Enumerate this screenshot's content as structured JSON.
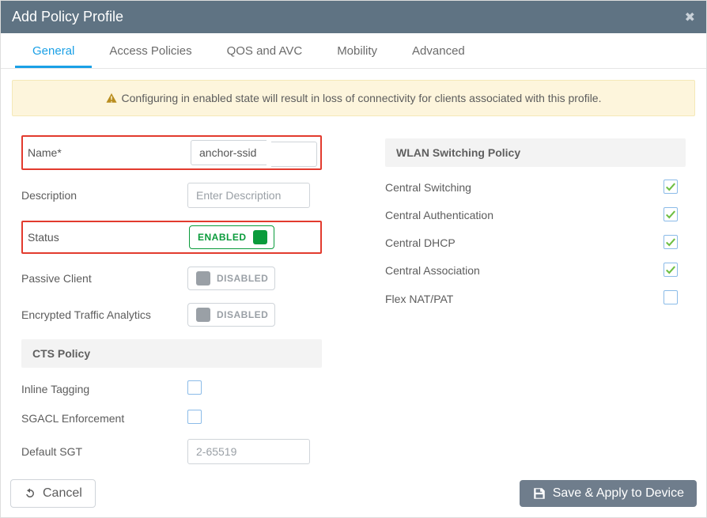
{
  "title": "Add Policy Profile",
  "tabs": [
    "General",
    "Access Policies",
    "QOS and AVC",
    "Mobility",
    "Advanced"
  ],
  "active_tab": 0,
  "alert": "Configuring in enabled state will result in loss of connectivity for clients associated with this profile.",
  "left": {
    "name_label": "Name*",
    "name_value": "anchor-ssid",
    "description_label": "Description",
    "description_placeholder": "Enter Description",
    "status_label": "Status",
    "status_value": "ENABLED",
    "passive_client_label": "Passive Client",
    "passive_client_value": "DISABLED",
    "eta_label": "Encrypted Traffic Analytics",
    "eta_value": "DISABLED",
    "cts_header": "CTS Policy",
    "inline_tagging_label": "Inline Tagging",
    "inline_tagging_checked": false,
    "sgacl_label": "SGACL Enforcement",
    "sgacl_checked": false,
    "default_sgt_label": "Default SGT",
    "default_sgt_placeholder": "2-65519"
  },
  "right": {
    "wlan_header": "WLAN Switching Policy",
    "items": [
      {
        "label": "Central Switching",
        "checked": true
      },
      {
        "label": "Central Authentication",
        "checked": true
      },
      {
        "label": "Central DHCP",
        "checked": true
      },
      {
        "label": "Central Association",
        "checked": true
      },
      {
        "label": "Flex NAT/PAT",
        "checked": false
      }
    ]
  },
  "footer": {
    "cancel": "Cancel",
    "save": "Save & Apply to Device"
  }
}
